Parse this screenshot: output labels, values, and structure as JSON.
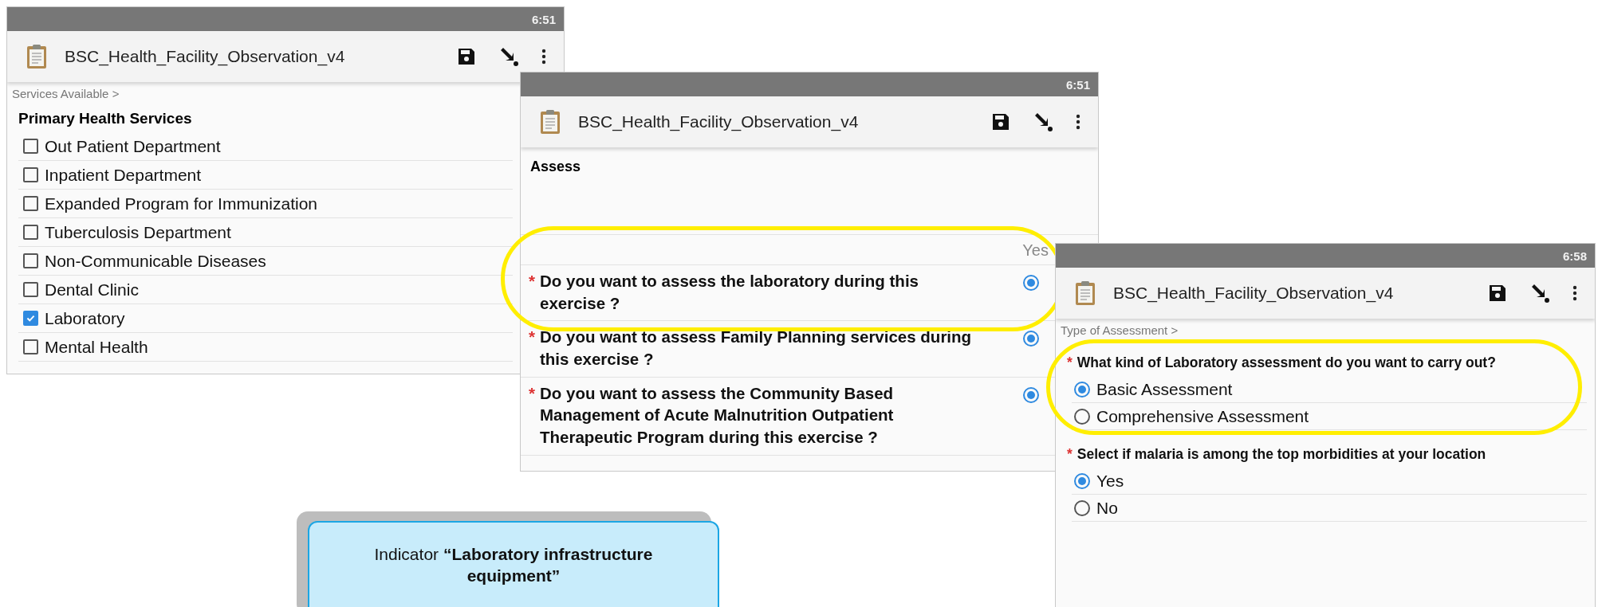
{
  "screens": [
    {
      "kind": "checklist",
      "time": "6:51",
      "title": "BSC_Health_Facility_Observation_v4",
      "breadcrumb": "Services Available >",
      "heading": "Primary Health Services",
      "items": [
        {
          "label": "Out Patient Department",
          "checked": false
        },
        {
          "label": "Inpatient Department",
          "checked": false
        },
        {
          "label": "Expanded Program for Immunization",
          "checked": false
        },
        {
          "label": "Tuberculosis Department",
          "checked": false
        },
        {
          "label": "Non-Communicable Diseases",
          "checked": false
        },
        {
          "label": "Dental Clinic",
          "checked": false
        },
        {
          "label": "Laboratory",
          "checked": true
        },
        {
          "label": "Mental Health",
          "checked": false
        }
      ]
    },
    {
      "kind": "matrix",
      "time": "6:51",
      "title": "BSC_Health_Facility_Observation_v4",
      "heading": "Assess",
      "column_label": "Yes",
      "questions": [
        {
          "marker": "*",
          "text": "Do you want to assess the laboratory during this exercise ?",
          "selected": true
        },
        {
          "marker": "*",
          "text": "Do you want to assess Family Planning services during this exercise ?",
          "selected": true
        },
        {
          "marker": "*",
          "text": "Do you want to assess the Community Based Management of Acute Malnutrition Outpatient Therapeutic Program during this exercise ?",
          "selected": true
        }
      ]
    },
    {
      "kind": "form",
      "time": "6:58",
      "title": "BSC_Health_Facility_Observation_v4",
      "breadcrumb": "Type of Assessment >",
      "questions": [
        {
          "marker": "*",
          "text": "What kind of Laboratory assessment do you want to carry out?",
          "options": [
            {
              "label": "Basic Assessment",
              "selected": true
            },
            {
              "label": "Comprehensive Assessment",
              "selected": false
            }
          ]
        },
        {
          "marker": "*",
          "text": "Select if malaria is among the top morbidities at your location",
          "options": [
            {
              "label": "Yes",
              "selected": true
            },
            {
              "label": "No",
              "selected": false
            }
          ]
        }
      ]
    }
  ],
  "callout": {
    "text": "Indicator **“Laboratory infrastructure equipment”**"
  }
}
